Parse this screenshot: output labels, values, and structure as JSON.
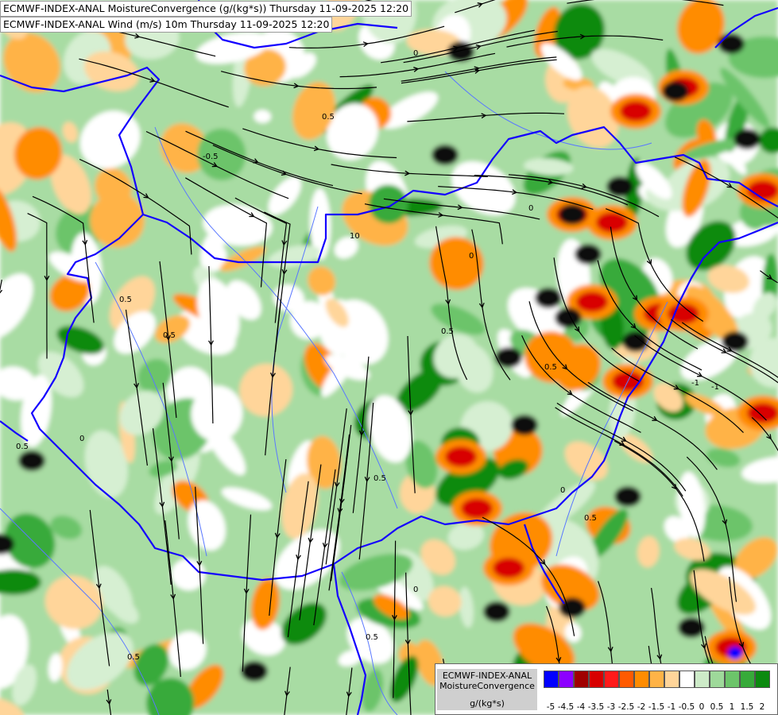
{
  "header": {
    "line1": "ECMWF-INDEX-ANAL MoistureConvergence (g/(kg*s)) Thursday 11-09-2025 12:20",
    "line2": "ECMWF-INDEX-ANAL Wind (m/s) 10m Thursday 11-09-2025 12:20"
  },
  "legend": {
    "model": "ECMWF-INDEX-ANAL",
    "parameter": "MoistureConvergence",
    "unit": "g/(kg*s)",
    "colors": [
      "#0000ff",
      "#8c00ff",
      "#a00000",
      "#d80000",
      "#ff1a1a",
      "#ff5a00",
      "#ff8c00",
      "#ffb347",
      "#ffd59a",
      "#ffffff",
      "#cdebc8",
      "#9ed99a",
      "#6cc46a",
      "#37aa3a",
      "#0c8a10"
    ],
    "ticks": [
      "-5",
      "-4.5",
      "-4",
      "-3.5",
      "-3",
      "-2.5",
      "-2",
      "-1.5",
      "-1",
      "-0.5",
      "0",
      "0.5",
      "1",
      "1.5",
      "2"
    ]
  },
  "contour_labels": [
    "0",
    "0.5",
    "-0.5",
    "10",
    "0.5",
    "0",
    "0.5",
    "0",
    "0.5",
    "-1",
    "0.5",
    "0",
    "0.5",
    "0.5",
    "0",
    "0.5",
    "0.5",
    "0",
    "-1",
    "0.5"
  ],
  "colors": {
    "border": "#1400ff",
    "river": "#5a78ff",
    "streamline": "#000000",
    "strong_convergence": "#0a0a0a"
  }
}
